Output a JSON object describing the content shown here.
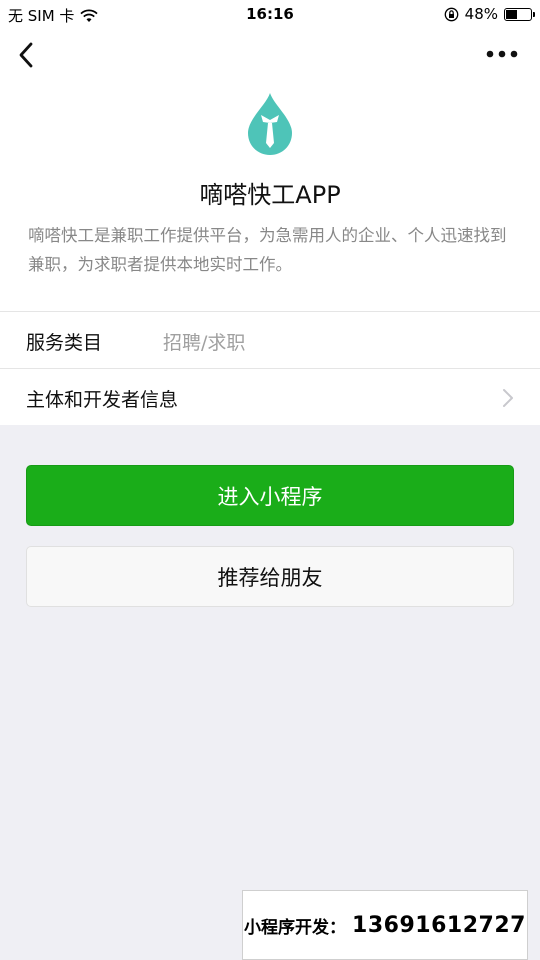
{
  "status_bar": {
    "carrier": "无 SIM 卡",
    "time": "16:16",
    "battery": "48%",
    "battery_level": 0.48
  },
  "nav": {
    "back_icon": "chevron-left-icon",
    "more_icon": "more-dots-icon"
  },
  "app": {
    "name": "嘀嗒快工APP",
    "description": "嘀嗒快工是兼职工作提供平台，为急需用人的企业、个人迅速找到兼职，为求职者提供本地实时工作。",
    "logo_icon": "drop-tie-logo",
    "logo_color": "#4ec4b8"
  },
  "info_rows": [
    {
      "label": "服务类目",
      "value": "招聘/求职"
    },
    {
      "label": "主体和开发者信息",
      "value": ""
    }
  ],
  "buttons": {
    "enter_label": "进入小程序",
    "share_label": "推荐给朋友"
  },
  "colors": {
    "accent_green": "#1aad19",
    "page_background": "#efeff4"
  },
  "promo": {
    "label": "小程序开发：",
    "value": "13691612727"
  }
}
